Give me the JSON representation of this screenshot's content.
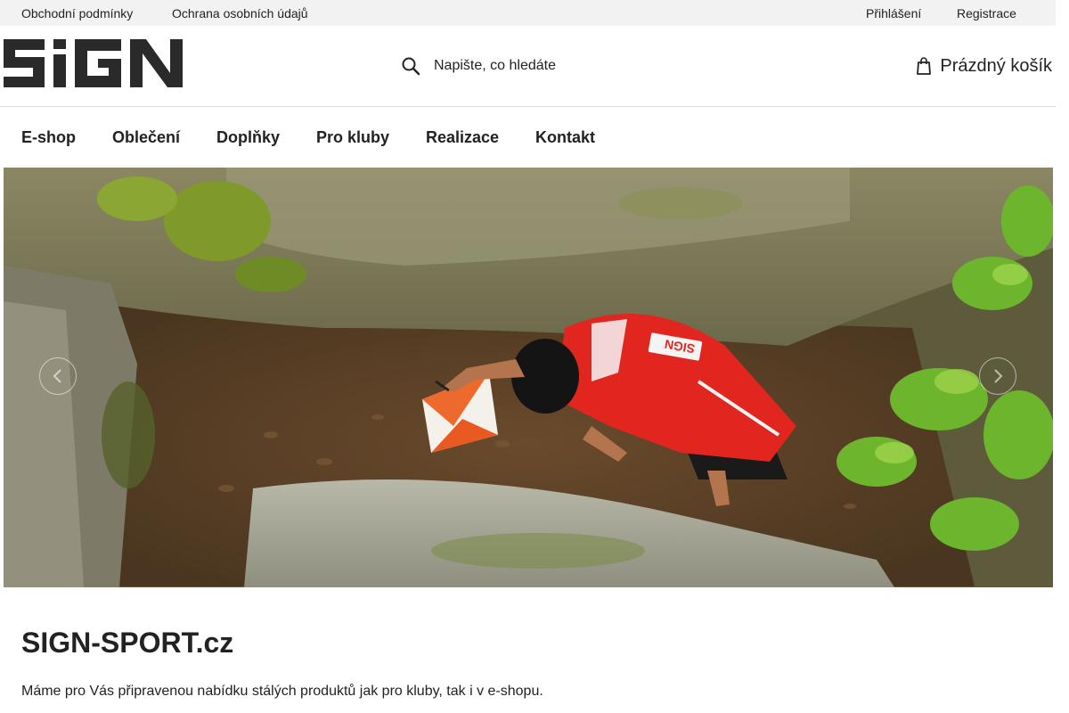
{
  "topbar": {
    "links_left": [
      "Obchodní podmínky",
      "Ochrana osobních údajů"
    ],
    "login": "Přihlášení",
    "register": "Registrace"
  },
  "header": {
    "logo_text": "SIGN",
    "search_placeholder": "Napište, co hledáte",
    "cart_label": "Prázdný košík"
  },
  "nav": {
    "items": [
      "E-shop",
      "Oblečení",
      "Doplňky",
      "Pro kluby",
      "Realizace",
      "Kontakt"
    ]
  },
  "hero": {
    "jersey_text": "SIGN",
    "icons": {
      "prev": "chevron-left-icon",
      "next": "chevron-right-icon"
    }
  },
  "content": {
    "title": "SIGN-SPORT.cz",
    "intro": "Máme pro Vás připravenou nabídku stálých produktů jak pro kluby, tak i v e-shopu."
  },
  "colors": {
    "topbar_bg": "#f2f2f2",
    "text": "#222222",
    "logo": "#2a2a2a",
    "jersey_red": "#e0261f"
  }
}
